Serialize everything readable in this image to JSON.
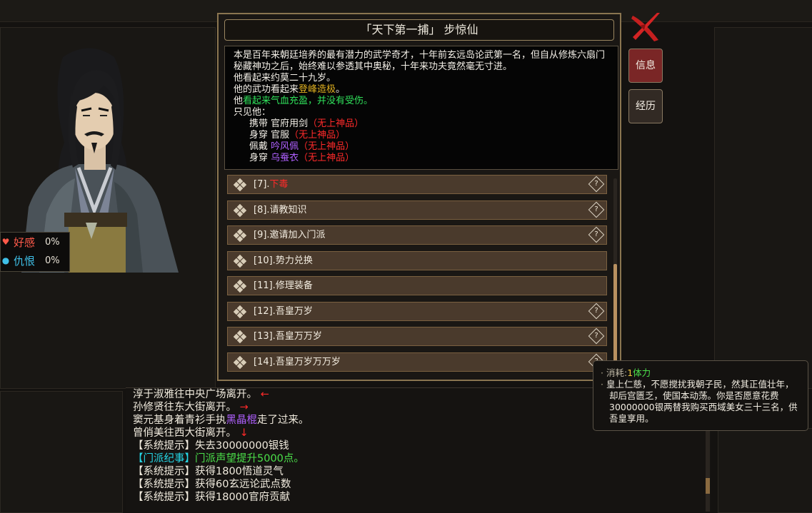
{
  "character": {
    "title": "「天下第一捕」 步惊仙",
    "stats": [
      {
        "label": "好感",
        "value": "0%"
      },
      {
        "label": "仇恨",
        "value": "0%"
      }
    ]
  },
  "tabs": {
    "info": "信息",
    "experience": "经历"
  },
  "description": {
    "intro": "本是百年来朝廷培养的最有潜力的武学奇才，十年前玄远岛论武第一名，但自从修炼六扇门秘藏神功之后，始终难以参透其中奥秘，十年来功夫竟然毫无寸进。",
    "age": "他看起来约莫二十九岁。",
    "martial_prefix": "他的武功看起来",
    "martial_level": "登峰造极",
    "martial_suffix": "。",
    "health_prefix": "他",
    "health_text": "看起来气血充盈，并没有受伤。",
    "see_label": "只见他：",
    "equipment": [
      {
        "verb": "携带",
        "item": "官府用剑",
        "quality": "（无上神品）",
        "item_color": "white"
      },
      {
        "verb": "身穿",
        "item": "官服",
        "quality": "（无上神品）",
        "item_color": "white"
      },
      {
        "verb": "佩戴",
        "item": "吟风佩",
        "quality": "（无上神品）",
        "item_color": "purple"
      },
      {
        "verb": "身穿",
        "item": "乌蚕衣",
        "quality": "（无上神品）",
        "item_color": "purple"
      }
    ]
  },
  "options": [
    {
      "num": "[7].",
      "label": "下毒",
      "label_color": "red",
      "help": true
    },
    {
      "num": "[8].",
      "label": "请教知识",
      "label_color": "white",
      "help": true
    },
    {
      "num": "[9].",
      "label": "邀请加入门派",
      "label_color": "white",
      "help": true
    },
    {
      "num": "[10].",
      "label": "势力兑换",
      "label_color": "white",
      "help": false
    },
    {
      "num": "[11].",
      "label": "修理装备",
      "label_color": "white",
      "help": false
    },
    {
      "num": "[12].",
      "label": "吾皇万岁",
      "label_color": "white",
      "help": true
    },
    {
      "num": "[13].",
      "label": "吾皇万万岁",
      "label_color": "white",
      "help": true
    },
    {
      "num": "[14].",
      "label": "吾皇万岁万万岁",
      "label_color": "white",
      "help": true
    }
  ],
  "option_help_glyph": "?",
  "tooltip": {
    "cost_label": "消耗:",
    "cost_value": "1",
    "cost_unit": "体力",
    "body": "皇上仁慈，不愿搅扰我朝子民，然其正值壮年，却后宫匮乏，使国本动荡。你是否愿意花费30000000银两替我购买西域美女三十三名，供吾皇享用。"
  },
  "log": [
    {
      "parts": [
        {
          "t": "淳于淑雅往中央广场离开。",
          "c": ""
        },
        {
          "t": " ←",
          "c": "red"
        }
      ]
    },
    {
      "parts": [
        {
          "t": "孙修贤往东大街离开。",
          "c": ""
        },
        {
          "t": " →",
          "c": "red"
        }
      ]
    },
    {
      "parts": [
        {
          "t": "窦元基身着青衫手执",
          "c": ""
        },
        {
          "t": "黑晶棍",
          "c": "purple"
        },
        {
          "t": "走了过来。",
          "c": ""
        }
      ]
    },
    {
      "parts": [
        {
          "t": "曾俏美往西大街离开。",
          "c": ""
        },
        {
          "t": " ↓",
          "c": "red"
        }
      ]
    },
    {
      "parts": [
        {
          "t": "【系统提示】失去30000000银钱",
          "c": ""
        }
      ]
    },
    {
      "parts": [
        {
          "t": "【门派纪事】",
          "c": "cyan"
        },
        {
          "t": "门派声望提升5000点。",
          "c": "lgreen"
        }
      ]
    },
    {
      "parts": [
        {
          "t": "【系统提示】获得1800悟道灵气",
          "c": ""
        }
      ]
    },
    {
      "parts": [
        {
          "t": "【系统提示】获得60玄远论武点数",
          "c": ""
        }
      ]
    },
    {
      "parts": [
        {
          "t": "【系统提示】获得18000官府贡献",
          "c": ""
        }
      ]
    }
  ],
  "colors": {
    "accent_red": "#ff2a2a",
    "gold": "#e0b020",
    "green": "#2fe05a",
    "purple": "#b060ff",
    "cyan": "#25d7e6",
    "option_bg": "#4a3a2c",
    "active_tab": "#7a2626"
  }
}
